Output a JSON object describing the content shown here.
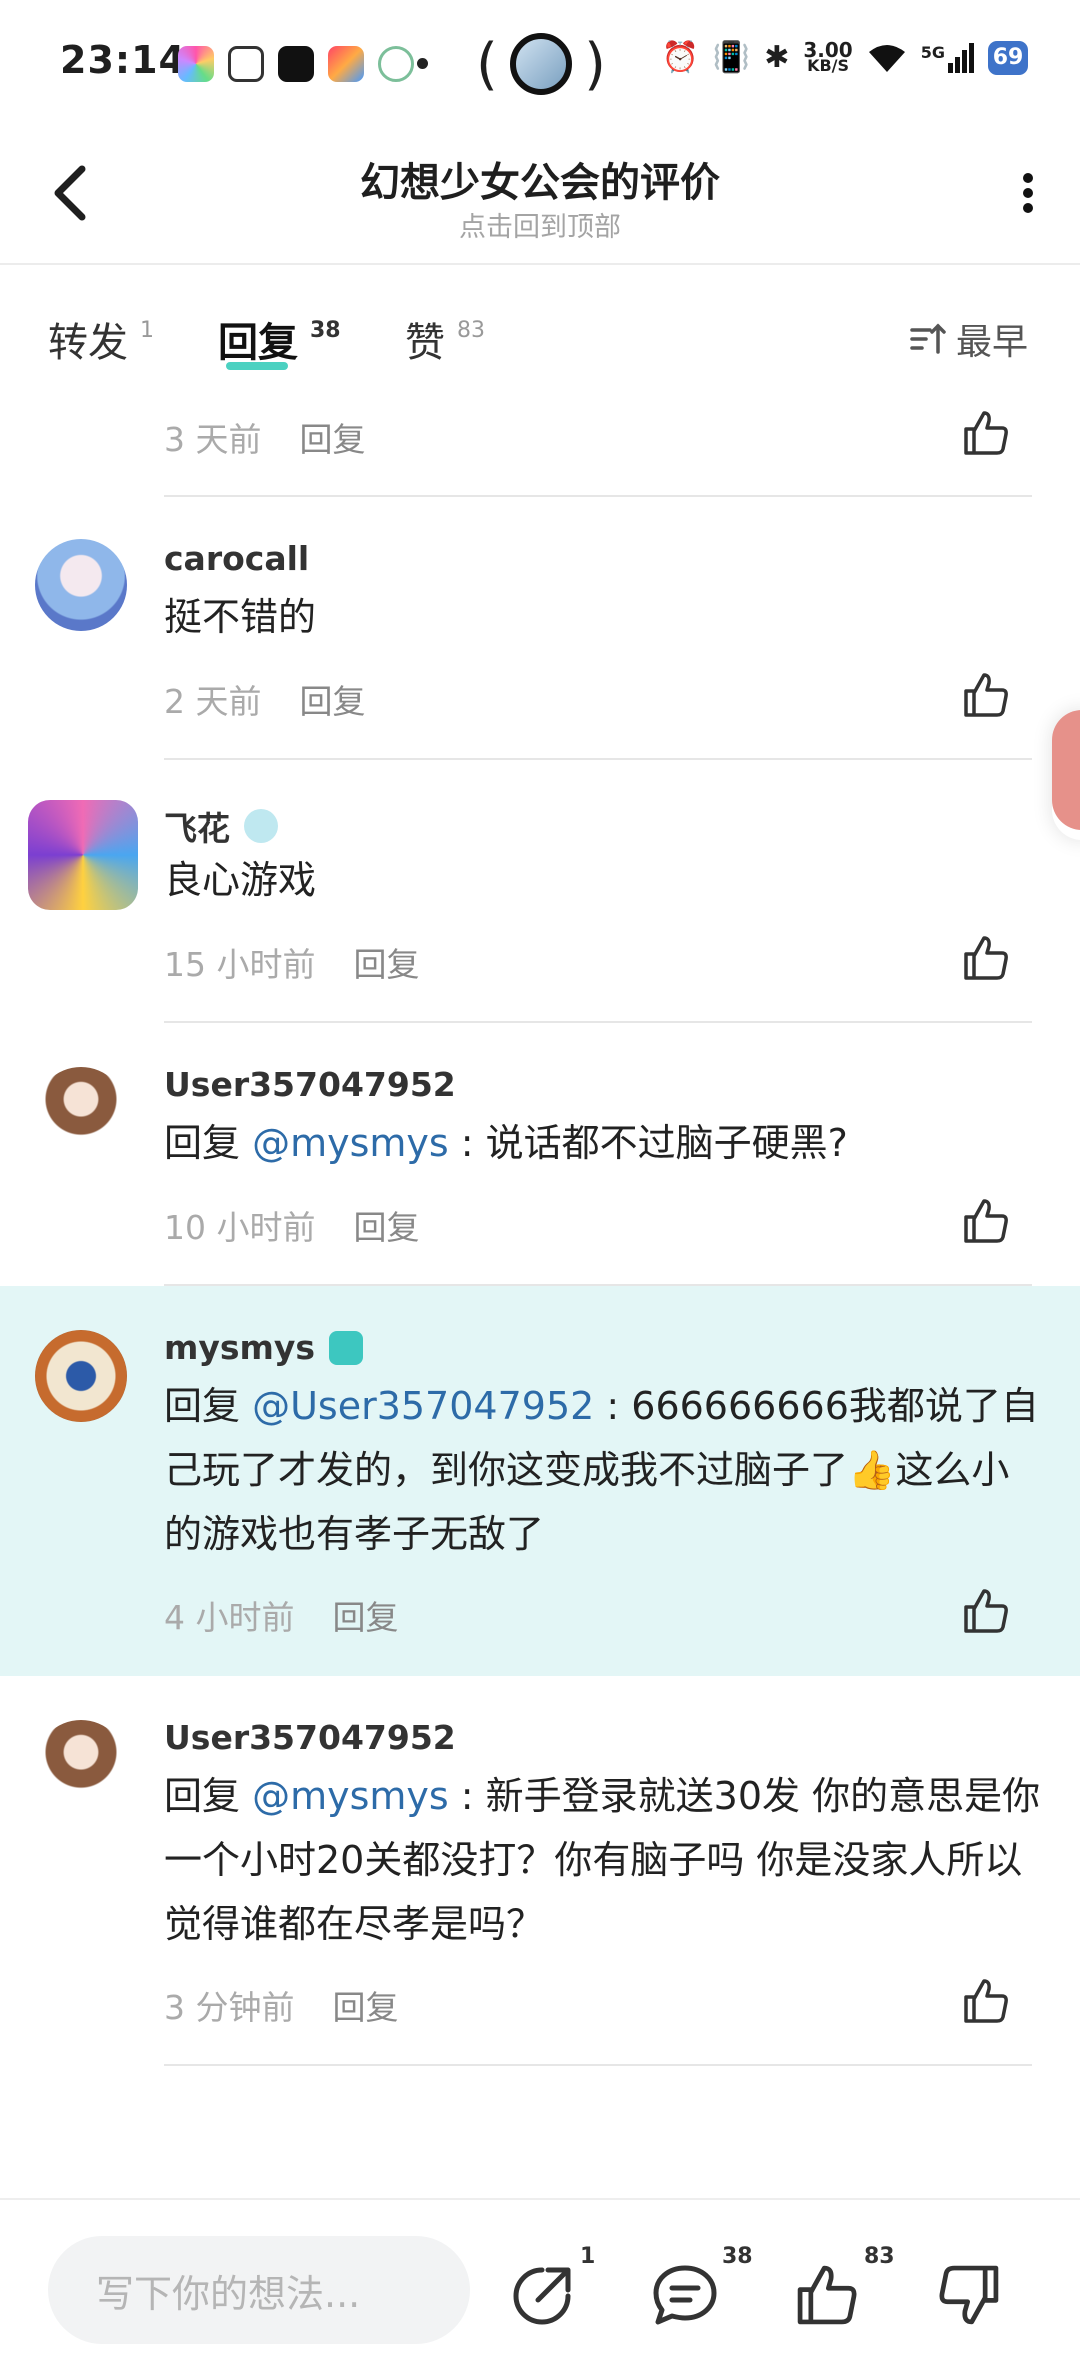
{
  "status_bar": {
    "time": "23:14",
    "network_speed_top": "3.00",
    "network_speed_unit": "KB/S",
    "signal_label": "5G",
    "battery": "69",
    "app_icons": [
      "photos-icon",
      "unknown-app-icon",
      "tiktok-icon",
      "star-app-icon",
      "alipay-icon"
    ],
    "system_icons": [
      "alarm-icon",
      "vibrate-icon",
      "bluetooth-icon",
      "wifi-icon",
      "signal-icon",
      "battery-icon"
    ]
  },
  "header": {
    "title": "幻想少女公会的评价",
    "subtitle": "点击回到顶部"
  },
  "tabs": [
    {
      "label": "转发",
      "count": "1"
    },
    {
      "label": "回复",
      "count": "38"
    },
    {
      "label": "赞",
      "count": "83"
    }
  ],
  "sort_label": "最早",
  "comments": [
    {
      "username": "",
      "text": "",
      "time": "3 天前",
      "reply_label": "回复"
    },
    {
      "username": "carocall",
      "text": "挺不错的",
      "time": "2 天前",
      "reply_label": "回复"
    },
    {
      "username": "飞花",
      "text": "良心游戏",
      "time": "15 小时前",
      "reply_label": "回复"
    },
    {
      "username": "User357047952",
      "reply_prefix": "回复 ",
      "mention": "@mysmys",
      "text": " : 说话都不过脑子硬黑?",
      "time": "10 小时前",
      "reply_label": "回复"
    },
    {
      "username": "mysmys",
      "reply_prefix": "回复 ",
      "mention": "@User357047952",
      "text": " : 666666666我都说了自己玩了才发的，到你这变成我不过脑子了👍这么小的游戏也有孝子无敌了",
      "time": "4 小时前",
      "reply_label": "回复"
    },
    {
      "username": "User357047952",
      "reply_prefix": "回复 ",
      "mention": "@mysmys",
      "text": " : 新手登录就送30发 你的意思是你一个小时20关都没打？你有脑子吗 你是没家人所以觉得谁都在尽孝是吗？",
      "time": "3 分钟前",
      "reply_label": "回复"
    }
  ],
  "bottom_bar": {
    "input_placeholder": "写下你的想法...",
    "share_count": "1",
    "comment_count": "38",
    "like_count": "83"
  },
  "colors": {
    "accent": "#1ec5b2",
    "mention": "#2d6ba8",
    "highlight_bg": "#e3f6f6"
  }
}
